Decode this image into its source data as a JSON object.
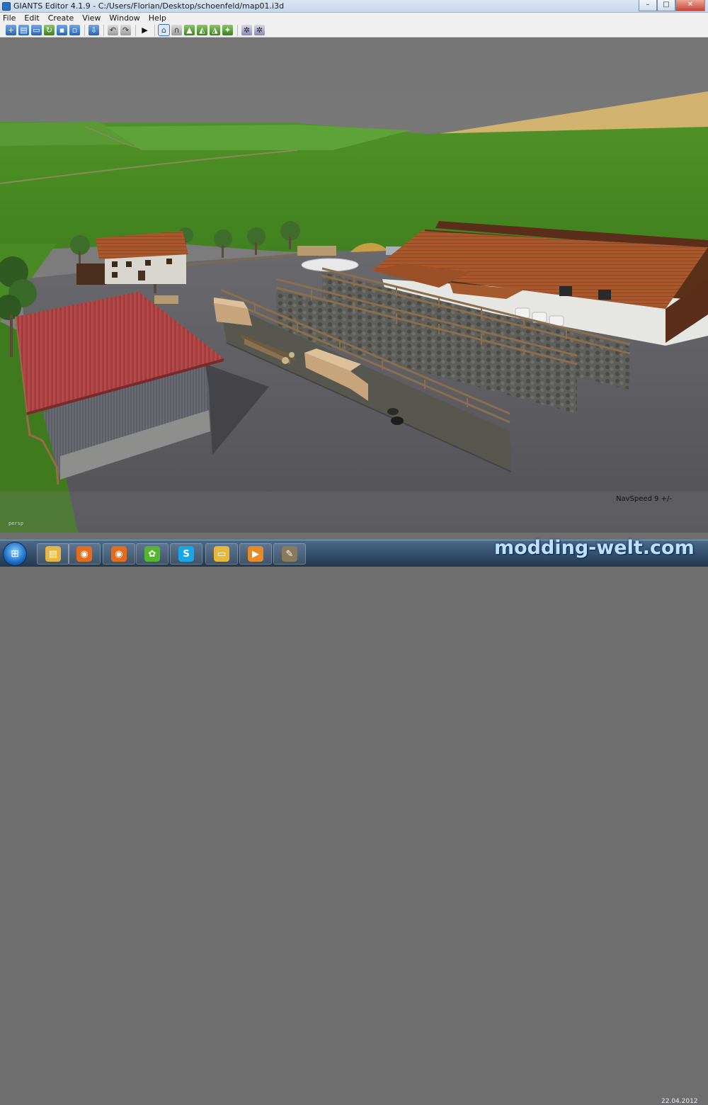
{
  "window": {
    "title": "GIANTS Editor 4.1.9 - C:/Users/Florian/Desktop/schoenfeld/map01.i3d",
    "minimize_glyph": "–",
    "maximize_glyph": "□",
    "close_glyph": "✕"
  },
  "menu": [
    "File",
    "Edit",
    "Create",
    "View",
    "Window",
    "Help"
  ],
  "toolbar": {
    "icons": [
      "new-file-icon",
      "open-file-icon",
      "open-folder-icon",
      "refresh-icon",
      "save-icon",
      "save-as-icon",
      "import-icon",
      "undo-icon",
      "redo-icon",
      "play-icon",
      "select-mode-icon",
      "magnet-icon",
      "terrain-sculpt-icon",
      "terrain-paint-icon",
      "foliage-paint-icon",
      "foliage-icon",
      "snap-icon",
      "settings-icon"
    ]
  },
  "viewport": {
    "camera_label": "persp",
    "status_text": "NavSpeed 9 +/-"
  },
  "taskbar": {
    "start_label": "⊞",
    "apps": [
      {
        "name": "explorer",
        "glyph": "▤",
        "color": "#e7b542"
      },
      {
        "name": "firefox",
        "glyph": "◉",
        "color": "#e46a1c"
      },
      {
        "name": "firefox-2",
        "glyph": "◉",
        "color": "#e46a1c"
      },
      {
        "name": "icq",
        "glyph": "✿",
        "color": "#55b632"
      },
      {
        "name": "skype",
        "glyph": "S",
        "color": "#19a6e6"
      },
      {
        "name": "files",
        "glyph": "▭",
        "color": "#e9b739"
      },
      {
        "name": "media-player",
        "glyph": "▶",
        "color": "#e88a25"
      },
      {
        "name": "gimp",
        "glyph": "✎",
        "color": "#8a7a5c"
      }
    ],
    "watermark": "modding-welt.com",
    "date": "22.04.2012"
  }
}
